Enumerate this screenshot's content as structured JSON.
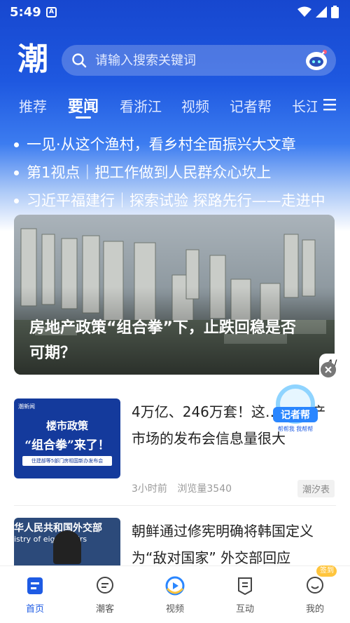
{
  "status_bar": {
    "time": "5:49",
    "notification_letter": "A"
  },
  "header": {
    "logo_text": "潮"
  },
  "search": {
    "placeholder": "请输入搜索关键词"
  },
  "tabs": [
    {
      "label": "推荐",
      "active": false
    },
    {
      "label": "要闻",
      "active": true
    },
    {
      "label": "看浙江",
      "active": false
    },
    {
      "label": "视频",
      "active": false
    },
    {
      "label": "记者帮",
      "active": false
    },
    {
      "label": "长江",
      "active": false
    }
  ],
  "headlines": [
    "一见·从这个渔村，看乡村全面振兴大文章",
    "第1视点｜把工作做到人民群众心坎上",
    "习近平福建行｜探索试验 探路先行——走进中"
  ],
  "hero": {
    "title": "房地产政策“组合拳”下，止跌回稳是否可期？",
    "page_indicator": "4/"
  },
  "floating_badge": {
    "line1": "记者帮",
    "line2": "帮帮我 我帮帮"
  },
  "news": [
    {
      "title": "4万亿、246万套！这… 房地产市场的发布会信息量很大",
      "time": "3小时前",
      "views": "浏览量3540",
      "source": "潮汐表",
      "thumb": {
        "brand": "潮新闻",
        "line1": "楼市政策",
        "line2": "“组合拳”来了！",
        "line3": "住建部等5部门房相国新办发布会"
      }
    },
    {
      "title": "朝鲜通过修宪明确将韩国定义为“敌对国家” 外交部回应",
      "thumb": {
        "line1": "华人民共和国外交部",
        "line2": "istry of  eign Affairs"
      }
    }
  ],
  "bottom_nav": [
    {
      "label": "首页",
      "icon": "home-icon",
      "active": true
    },
    {
      "label": "潮客",
      "icon": "chat-icon",
      "active": false
    },
    {
      "label": "视频",
      "icon": "video-icon",
      "active": false
    },
    {
      "label": "互动",
      "icon": "interact-icon",
      "active": false
    },
    {
      "label": "我的",
      "icon": "profile-icon",
      "active": false
    }
  ],
  "signin_badge": "签到",
  "colors": {
    "brand_blue": "#1e5be4",
    "header_blue": "#1747cf",
    "signin_yellow": "#ffc53d"
  }
}
